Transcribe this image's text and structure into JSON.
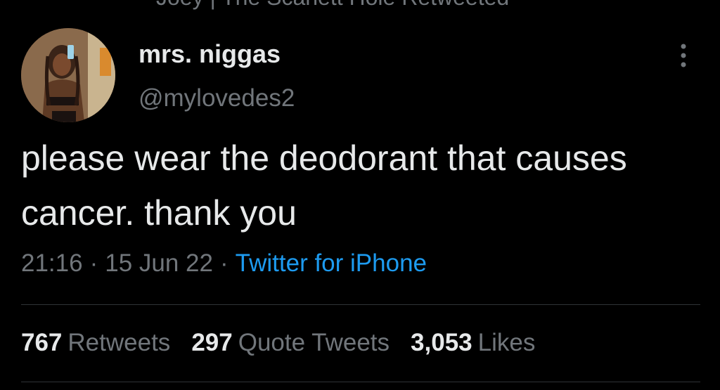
{
  "context_line": "Joey | The Scarlett Hole  Retweeted",
  "author": {
    "display_name": "mrs. niggas",
    "handle": "@mylovedes2",
    "avatar_icon": "profile-photo"
  },
  "tweet": {
    "text": "please wear the deodorant that causes cancer. thank you",
    "time": "21:16",
    "date": "15 Jun 22",
    "source": "Twitter for iPhone",
    "separator": "·"
  },
  "stats": {
    "retweets_count": "767",
    "retweets_label": "Retweets",
    "quotes_count": "297",
    "quotes_label": "Quote Tweets",
    "likes_count": "3,053",
    "likes_label": "Likes"
  },
  "colors": {
    "background": "#000000",
    "primary_text": "#e7e9ea",
    "secondary_text": "#71767b",
    "link": "#1d9bf0",
    "divider": "#2f3336"
  }
}
